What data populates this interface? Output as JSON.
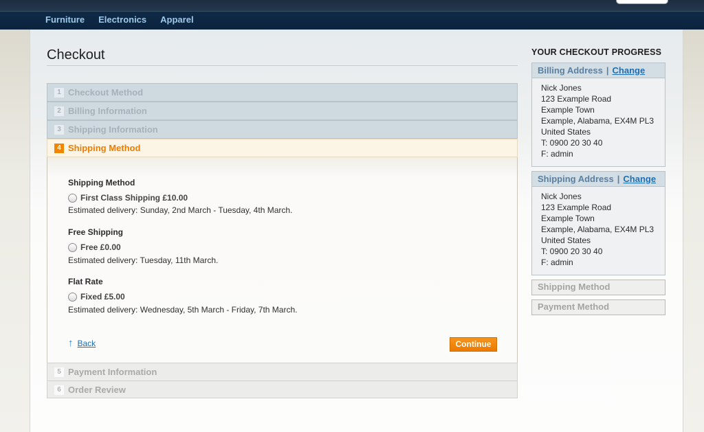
{
  "nav": {
    "items": [
      "Furniture",
      "Electronics",
      "Apparel"
    ]
  },
  "page": {
    "title": "Checkout"
  },
  "steps": [
    {
      "num": "1",
      "label": "Checkout Method"
    },
    {
      "num": "2",
      "label": "Billing Information"
    },
    {
      "num": "3",
      "label": "Shipping Information"
    },
    {
      "num": "4",
      "label": "Shipping Method"
    },
    {
      "num": "5",
      "label": "Payment Information"
    },
    {
      "num": "6",
      "label": "Order Review"
    }
  ],
  "shipping": {
    "groups": [
      {
        "title": "Shipping Method",
        "option": "First Class Shipping £10.00",
        "estimate": "Estimated delivery: Sunday, 2nd March - Tuesday, 4th March."
      },
      {
        "title": "Free Shipping",
        "option": "Free £0.00",
        "estimate": "Estimated delivery: Tuesday, 11th March."
      },
      {
        "title": "Flat Rate",
        "option": "Fixed £5.00",
        "estimate": "Estimated delivery: Wednesday, 5th March - Friday, 7th March."
      }
    ],
    "back_label": "Back",
    "continue_label": "Continue"
  },
  "sidebar": {
    "heading": "YOUR CHECKOUT PROGRESS",
    "change_label": "Change",
    "billing": {
      "title": "Billing Address",
      "lines": [
        "Nick Jones",
        "123 Example Road",
        "Example Town",
        "Example, Alabama, EX4M PL3",
        "United States",
        "T: 0900 20 30 40",
        "F: admin"
      ]
    },
    "shipping_address": {
      "title": "Shipping Address",
      "lines": [
        "Nick Jones",
        "123 Example Road",
        "Example Town",
        "Example, Alabama, EX4M PL3",
        "United States",
        "T: 0900 20 30 40",
        "F: admin"
      ]
    },
    "shipping_method_title": "Shipping Method",
    "payment_method_title": "Payment Method"
  }
}
